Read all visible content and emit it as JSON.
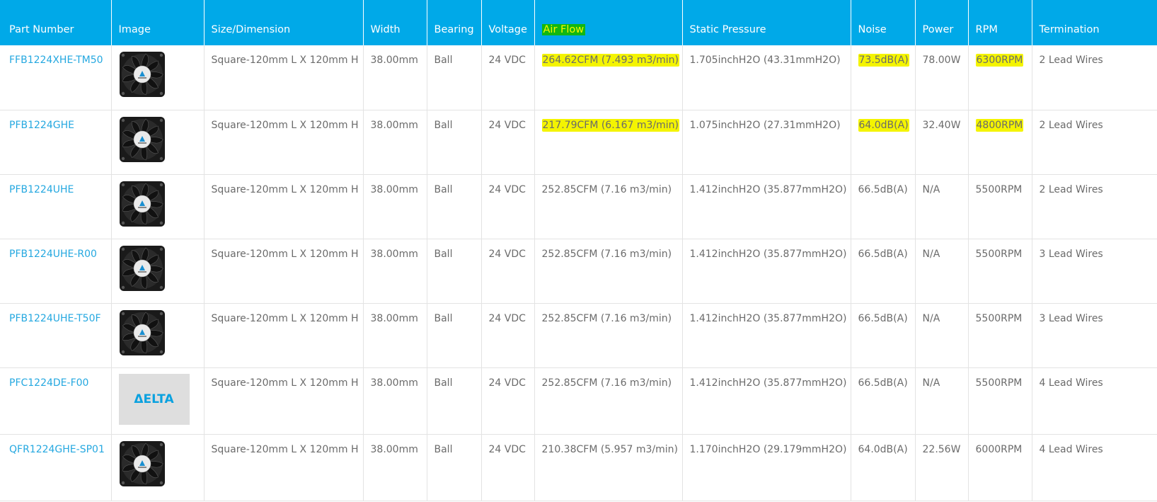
{
  "headers": {
    "part_number": "Part Number",
    "image": "Image",
    "size": "Size/Dimension",
    "width": "Width",
    "bearing": "Bearing",
    "voltage": "Voltage",
    "air_flow": "Air Flow",
    "static_pressure": "Static Pressure",
    "noise": "Noise",
    "power": "Power",
    "rpm": "RPM",
    "termination": "Termination"
  },
  "rows": [
    {
      "part": "FFB1224XHE-TM50",
      "image": "fan-icon",
      "size": "Square-120mm L X 120mm H",
      "width": "38.00mm",
      "bearing": "Ball",
      "voltage": "24 VDC",
      "air_flow": "264.62CFM (7.493 m3/min)",
      "static_pressure": "1.705inchH2O (43.31mmH2O)",
      "noise": "73.5dB(A)",
      "power": "78.00W",
      "rpm": "6300RPM",
      "termination": "2 Lead Wires"
    },
    {
      "part": "PFB1224GHE",
      "image": "fan-icon",
      "size": "Square-120mm L X 120mm H",
      "width": "38.00mm",
      "bearing": "Ball",
      "voltage": "24 VDC",
      "air_flow": "217.79CFM (6.167 m3/min)",
      "static_pressure": "1.075inchH2O (27.31mmH2O)",
      "noise": "64.0dB(A)",
      "power": "32.40W",
      "rpm": "4800RPM",
      "termination": "2 Lead Wires"
    },
    {
      "part": "PFB1224UHE",
      "image": "fan-icon",
      "size": "Square-120mm L X 120mm H",
      "width": "38.00mm",
      "bearing": "Ball",
      "voltage": "24 VDC",
      "air_flow": "252.85CFM (7.16 m3/min)",
      "static_pressure": "1.412inchH2O (35.877mmH2O)",
      "noise": "66.5dB(A)",
      "power": "N/A",
      "rpm": "5500RPM",
      "termination": "2 Lead Wires"
    },
    {
      "part": "PFB1224UHE-R00",
      "image": "fan-icon",
      "size": "Square-120mm L X 120mm H",
      "width": "38.00mm",
      "bearing": "Ball",
      "voltage": "24 VDC",
      "air_flow": "252.85CFM (7.16 m3/min)",
      "static_pressure": "1.412inchH2O (35.877mmH2O)",
      "noise": "66.5dB(A)",
      "power": "N/A",
      "rpm": "5500RPM",
      "termination": "3 Lead Wires"
    },
    {
      "part": "PFB1224UHE-T50F",
      "image": "fan-icon",
      "size": "Square-120mm L X 120mm H",
      "width": "38.00mm",
      "bearing": "Ball",
      "voltage": "24 VDC",
      "air_flow": "252.85CFM (7.16 m3/min)",
      "static_pressure": "1.412inchH2O (35.877mmH2O)",
      "noise": "66.5dB(A)",
      "power": "N/A",
      "rpm": "5500RPM",
      "termination": "3 Lead Wires"
    },
    {
      "part": "PFC1224DE-F00",
      "image": "delta-logo",
      "logo_text": "ΔELTA",
      "size": "Square-120mm L X 120mm H",
      "width": "38.00mm",
      "bearing": "Ball",
      "voltage": "24 VDC",
      "air_flow": "252.85CFM (7.16 m3/min)",
      "static_pressure": "1.412inchH2O (35.877mmH2O)",
      "noise": "66.5dB(A)",
      "power": "N/A",
      "rpm": "5500RPM",
      "termination": "4 Lead Wires"
    },
    {
      "part": "QFR1224GHE-SP01",
      "image": "fan-icon",
      "size": "Square-120mm L X 120mm H",
      "width": "38.00mm",
      "bearing": "Ball",
      "voltage": "24 VDC",
      "air_flow": "210.38CFM (5.957 m3/min)",
      "static_pressure": "1.170inchH2O (29.179mmH2O)",
      "noise": "64.0dB(A)",
      "power": "22.56W",
      "rpm": "6000RPM",
      "termination": "4 Lead Wires"
    }
  ],
  "colors": {
    "header_bg": "#00a9e8",
    "link": "#25a8e0",
    "highlight": "#f4f400",
    "airflow_header_bg": "#12b712"
  }
}
